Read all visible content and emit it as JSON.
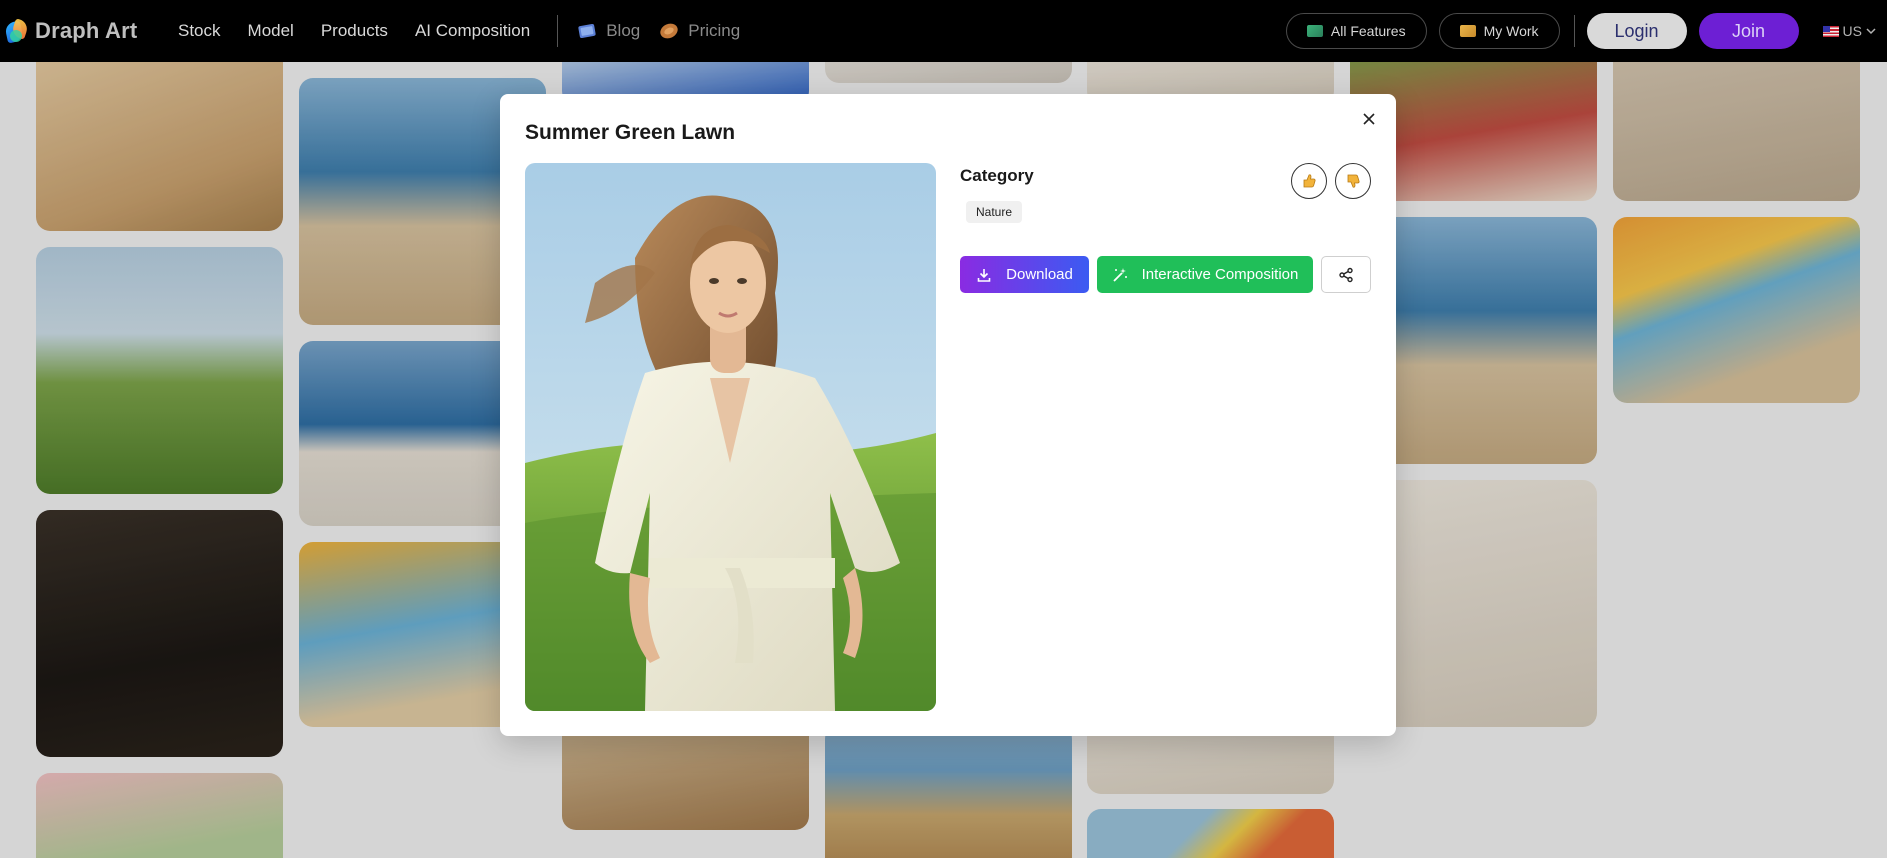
{
  "brand": {
    "name": "Draph Art"
  },
  "nav": {
    "links": [
      "Stock",
      "Model",
      "Products",
      "AI Composition"
    ],
    "blog": "Blog",
    "pricing": "Pricing",
    "all_features": "All Features",
    "my_work": "My Work",
    "login": "Login",
    "join": "Join",
    "language": "US"
  },
  "modal": {
    "title": "Summer Green Lawn",
    "category_label": "Category",
    "category_tag": "Nature",
    "download_label": "Download",
    "compose_label": "Interactive Composition",
    "preview_alt": "Woman in white shirt dress standing on green lawn"
  },
  "colors": {
    "nav_bg": "#000000",
    "join_purple": "#6d1fd4",
    "download_gradient": [
      "#8a2be2",
      "#3b5bf2"
    ],
    "compose_green": "#20bf59"
  },
  "icons": {
    "like": "thumbs-up-icon",
    "dislike": "thumbs-down-icon",
    "download": "download-icon",
    "compose": "magic-wand-icon",
    "share": "share-icon",
    "close": "close-icon"
  }
}
